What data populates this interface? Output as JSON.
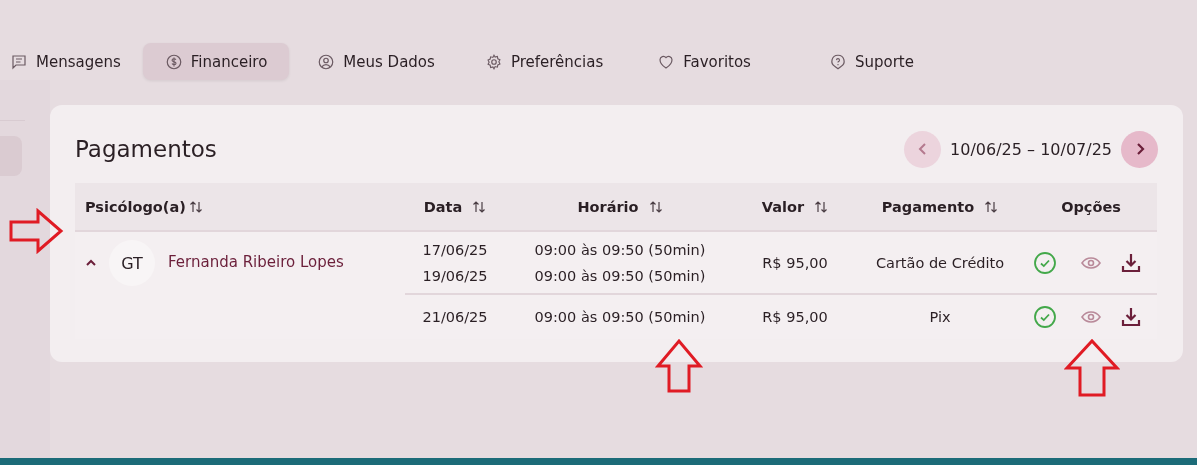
{
  "nav": [
    {
      "label": "Mensagens",
      "selected": false
    },
    {
      "label": "Financeiro",
      "selected": true
    },
    {
      "label": "Meus Dados",
      "selected": false
    },
    {
      "label": "Preferências",
      "selected": false
    },
    {
      "label": "Favoritos",
      "selected": false
    },
    {
      "label": "Suporte",
      "selected": false
    }
  ],
  "payments": {
    "title": "Pagamentos",
    "date_range": "10/06/25 – 10/07/25",
    "columns": [
      {
        "label": "Psicólogo(a)",
        "sortable": true
      },
      {
        "label": "Data",
        "sortable": true
      },
      {
        "label": "Horário",
        "sortable": true
      },
      {
        "label": "Valor",
        "sortable": true
      },
      {
        "label": "Pagamento",
        "sortable": true
      },
      {
        "label": "Opções",
        "sortable": false
      }
    ],
    "rows": [
      {
        "initials": "GT",
        "name": "Fernanda Ribeiro Lopes",
        "expanded": true,
        "entries": [
          {
            "dates": [
              "17/06/25",
              "19/06/25"
            ],
            "times": [
              "09:00 às 09:50 (50min)",
              "09:00 às 09:50 (50min)"
            ],
            "value": "R$ 95,00",
            "method": "Cartão de Crédito",
            "paid": true
          },
          {
            "dates": [
              "21/06/25"
            ],
            "times": [
              "09:00 às 09:50 (50min)"
            ],
            "value": "R$ 95,00",
            "method": "Pix",
            "paid": true
          }
        ]
      }
    ]
  }
}
